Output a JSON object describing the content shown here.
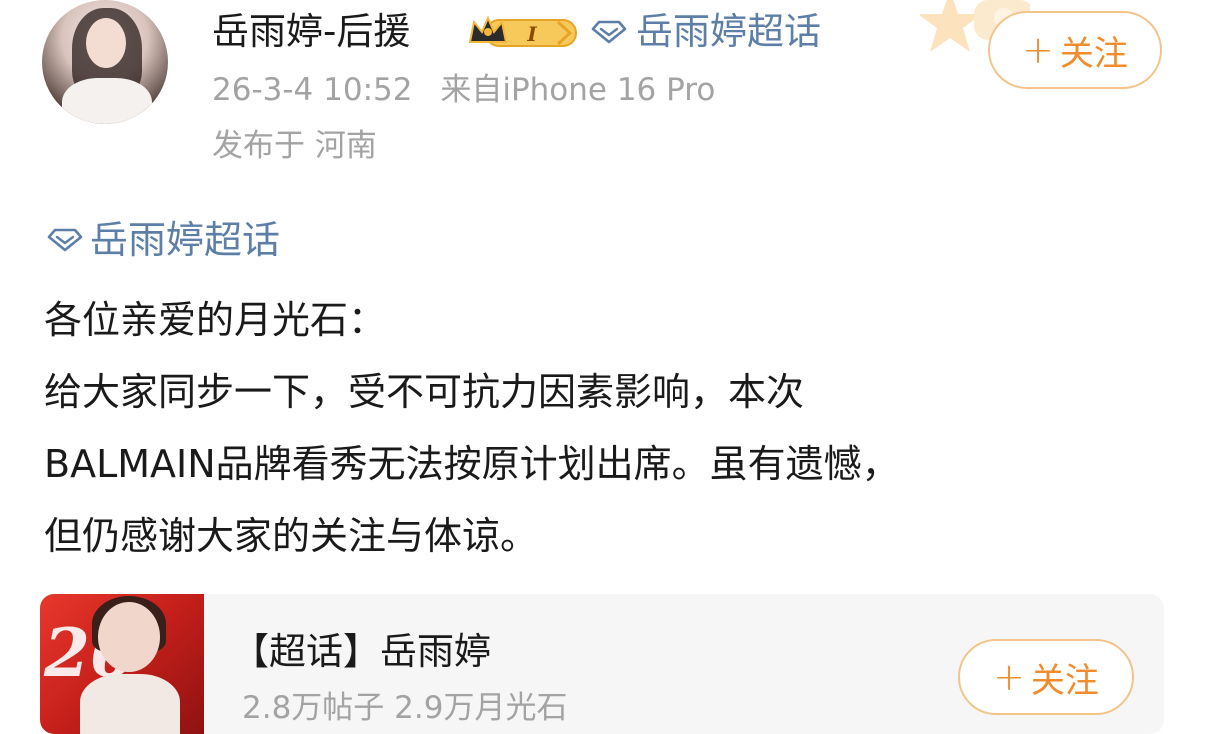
{
  "header": {
    "user_name": "岳雨婷-后援",
    "badge_level": "I",
    "topic_link": "岳雨婷超话",
    "follow_label": "关注",
    "timestamp": "26-3-4 10:52",
    "source": "来自iPhone 16 Pro",
    "location": "发布于 河南"
  },
  "post": {
    "topic_tag": "岳雨婷超话",
    "lines": [
      "各位亲爱的月光石：",
      "给大家同步一下，受不可抗力因素影响，本次",
      "BALMAIN品牌看秀无法按原计划出席。虽有遗憾，",
      "但仍感谢大家的关注与体谅。"
    ]
  },
  "topic_card": {
    "title": "【超话】岳雨婷",
    "stats": "2.8万帖子 2.9万月光石",
    "follow_label": "关注"
  },
  "colors": {
    "link_blue": "#5d7fa7",
    "follow_orange": "#f18c2b",
    "follow_border": "#f2c48a",
    "meta_gray": "#a3a3a3",
    "badge_gold": "#f4b73c"
  },
  "icons": {
    "plus": "plus-icon",
    "diamond": "super-topic-diamond-icon",
    "crown": "crown-icon"
  }
}
